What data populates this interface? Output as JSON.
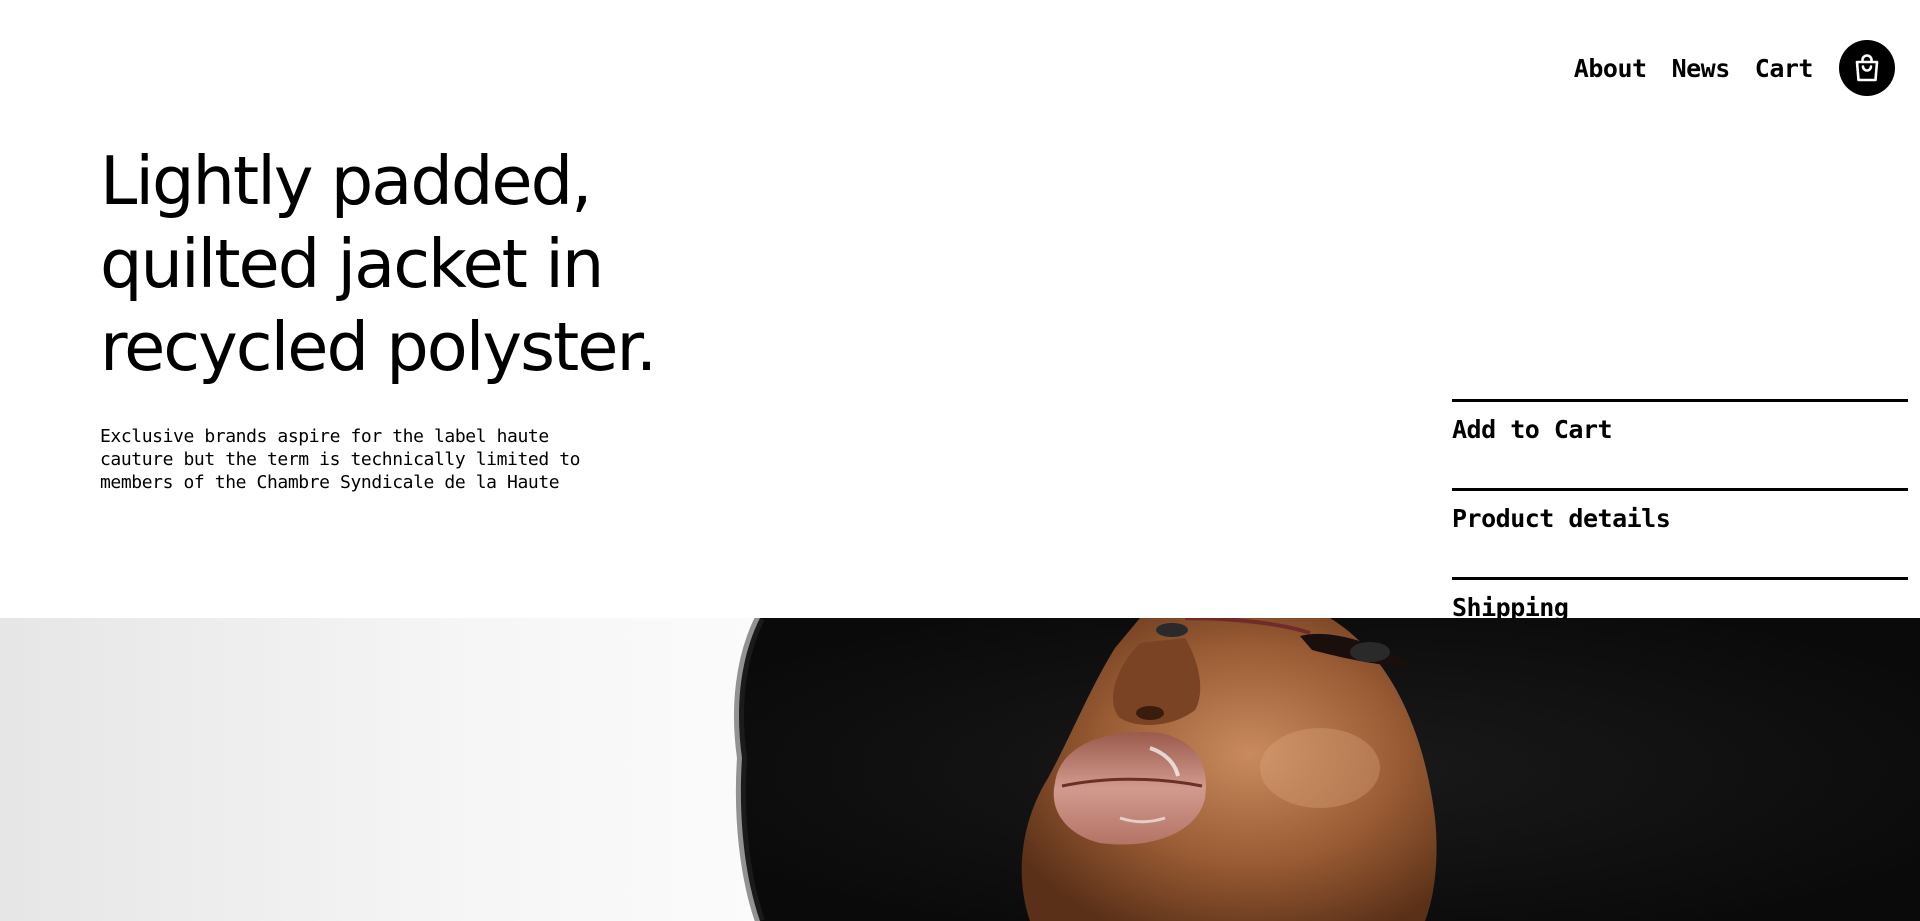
{
  "nav": {
    "links": [
      {
        "label": "About"
      },
      {
        "label": "News"
      },
      {
        "label": "Cart"
      }
    ],
    "cart_icon": "shopping-bag-icon"
  },
  "hero": {
    "headline_lines": [
      "Lightly padded,",
      "quilted jacket in",
      "recycled polyster."
    ],
    "description_lines": [
      "Exclusive brands aspire for the label haute",
      "cauture but the term is technically limited to",
      "members of the Chambre Syndicale de la Haute"
    ]
  },
  "accordion": {
    "items": [
      {
        "label": "Add to Cart"
      },
      {
        "label": "Product details"
      },
      {
        "label": "Shipping"
      }
    ]
  },
  "colors": {
    "background": "#ffffff",
    "text": "#000000",
    "accent": "#000000"
  }
}
